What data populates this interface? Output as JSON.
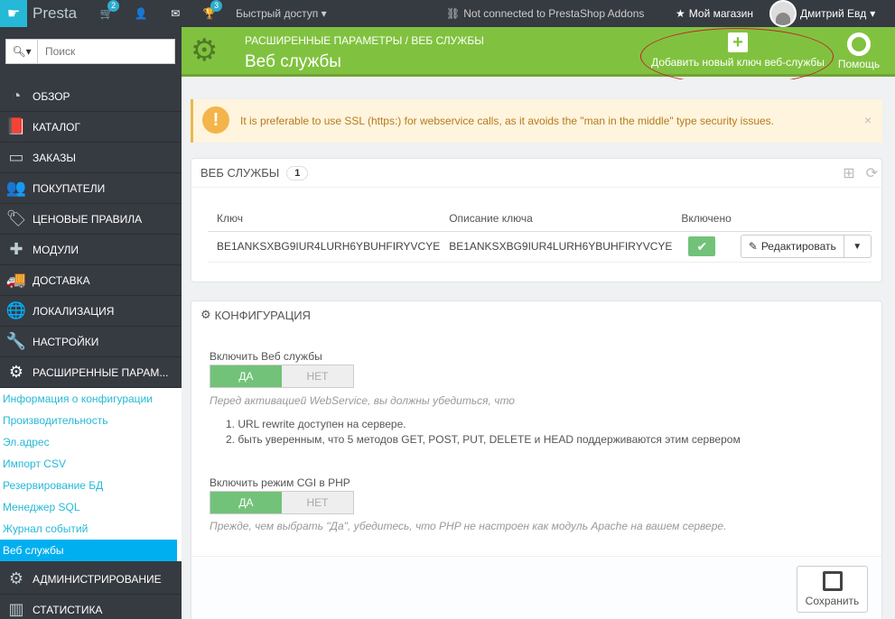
{
  "topbar": {
    "brand": "Presta",
    "cart_badge": "2",
    "trophy_badge": "3",
    "quick_access": "Быстрый доступ",
    "addons_status": "Not connected to PrestaShop Addons",
    "my_shop": "Мой магазин",
    "user_name": "Дмитрий Евд"
  },
  "sidebar": {
    "search_placeholder": "Поиск",
    "menu": [
      {
        "label": "ОБЗОР",
        "icon": "dashboard-icon"
      },
      {
        "label": "КАТАЛОГ",
        "icon": "book-icon"
      },
      {
        "label": "ЗАКАЗЫ",
        "icon": "credit-card-icon"
      },
      {
        "label": "ПОКУПАТЕЛИ",
        "icon": "users-icon"
      },
      {
        "label": "ЦЕНОВЫЕ ПРАВИЛА",
        "icon": "tag-icon"
      },
      {
        "label": "МОДУЛИ",
        "icon": "puzzle-icon"
      },
      {
        "label": "ДОСТАВКА",
        "icon": "truck-icon"
      },
      {
        "label": "ЛОКАЛИЗАЦИЯ",
        "icon": "globe-icon"
      },
      {
        "label": "НАСТРОЙКИ",
        "icon": "wrench-icon"
      },
      {
        "label": "РАСШИРЕННЫЕ ПАРАМ...",
        "icon": "gears-icon"
      }
    ],
    "submenu": [
      "Информация о конфигурации",
      "Производительность",
      "Эл.адрес",
      "Импорт CSV",
      "Резервирование БД",
      "Менеджер SQL",
      "Журнал событий",
      "Веб службы"
    ],
    "menu_after": [
      {
        "label": "АДМИНИСТРИРОВАНИЕ",
        "icon": "gear-icon"
      },
      {
        "label": "СТАТИСТИКА",
        "icon": "bar-chart-icon"
      }
    ]
  },
  "header": {
    "breadcrumb": "РАСШИРЕННЫЕ ПАРАМЕТРЫ  /  ВЕБ СЛУЖБЫ",
    "title": "Веб службы",
    "add_key": "Добавить новый ключ веб-службы",
    "help": "Помощь"
  },
  "alert": {
    "message": "It is preferable to use SSL (https:) for webservice calls, as it avoids the \"man in the middle\" type security issues.",
    "close": "×"
  },
  "webservices_panel": {
    "title": "ВЕБ СЛУЖБЫ",
    "count": "1",
    "columns": [
      "Ключ",
      "Описание ключа",
      "Включено"
    ],
    "rows": [
      {
        "key": "BE1ANKSXBG9IUR4LURH6YBUHFIRYVCYE",
        "description": "BE1ANKSXBG9IUR4LURH6YBUHFIRYVCYE",
        "enabled": "✔",
        "edit": "Редактировать"
      }
    ]
  },
  "config_panel": {
    "title": "КОНФИГУРАЦИЯ",
    "field1_label": "Включить Веб службы",
    "yes": "ДА",
    "no": "НЕТ",
    "hint1": "Перед активацией WebService, вы должны убедиться, что",
    "list": [
      "1.  URL rewrite доступен на сервере.",
      "2.  быть уверенным, что 5 методов GET, POST, PUT, DELETE и HEAD поддерживаются этим сервером"
    ],
    "field2_label": "Включить режим CGI в PHP",
    "hint2": "Прежде, чем выбрать \"Да\", убедитесь, что PHP не настроен как модуль Apache на вашем сервере.",
    "save": "Сохранить"
  }
}
